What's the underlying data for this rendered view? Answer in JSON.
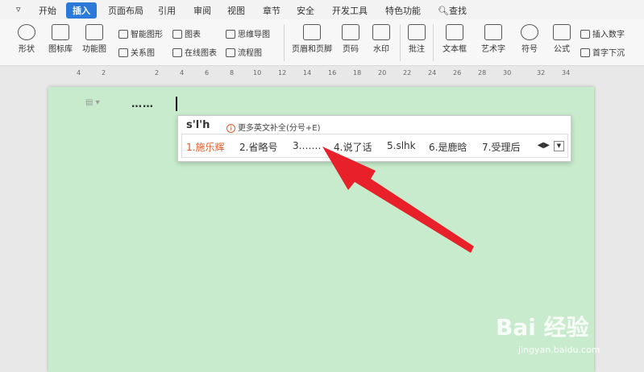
{
  "menubar": {
    "items": [
      "开始",
      "插入",
      "页面布局",
      "引用",
      "审阅",
      "视图",
      "章节",
      "安全",
      "开发工具",
      "特色功能"
    ],
    "active_index": 1,
    "search_label": "查找"
  },
  "ribbon": {
    "shape": "形状",
    "icon_lib": "图标库",
    "func_chart": "功能图",
    "smart_art": "智能图形",
    "chart": "图表",
    "mind_map": "思维导图",
    "relation": "关系图",
    "online_chart": "在线图表",
    "flowchart": "流程图",
    "header_footer": "页眉和页脚",
    "page_number": "页码",
    "watermark": "水印",
    "comment": "批注",
    "textbox": "文本框",
    "art_text": "艺术字",
    "symbol": "符号",
    "formula": "公式",
    "insert_number": "插入数字",
    "drop_cap": "首字下沉"
  },
  "ruler": {
    "ticks": [
      "4",
      "2",
      "2",
      "4",
      "6",
      "8",
      "10",
      "12",
      "14",
      "16",
      "18",
      "20",
      "22",
      "24",
      "26",
      "28",
      "30",
      "32",
      "34"
    ]
  },
  "document": {
    "typed_text": "……"
  },
  "ime": {
    "composition": "s'l'h",
    "hint": "更多英文补全(分号+E)",
    "candidates": [
      "1.施乐辉",
      "2.省略号",
      "3.……",
      "4.说了话",
      "5.slhk",
      "6.是鹿晗",
      "7.受理后"
    ]
  },
  "watermark": {
    "brand": "Bai 经验",
    "url": "jingyan.baidu.com"
  },
  "colors": {
    "page_bg": "#c7ebcc",
    "active_tab": "#2b79d8",
    "first_candidate": "#e05a28",
    "arrow": "#e8202a"
  }
}
